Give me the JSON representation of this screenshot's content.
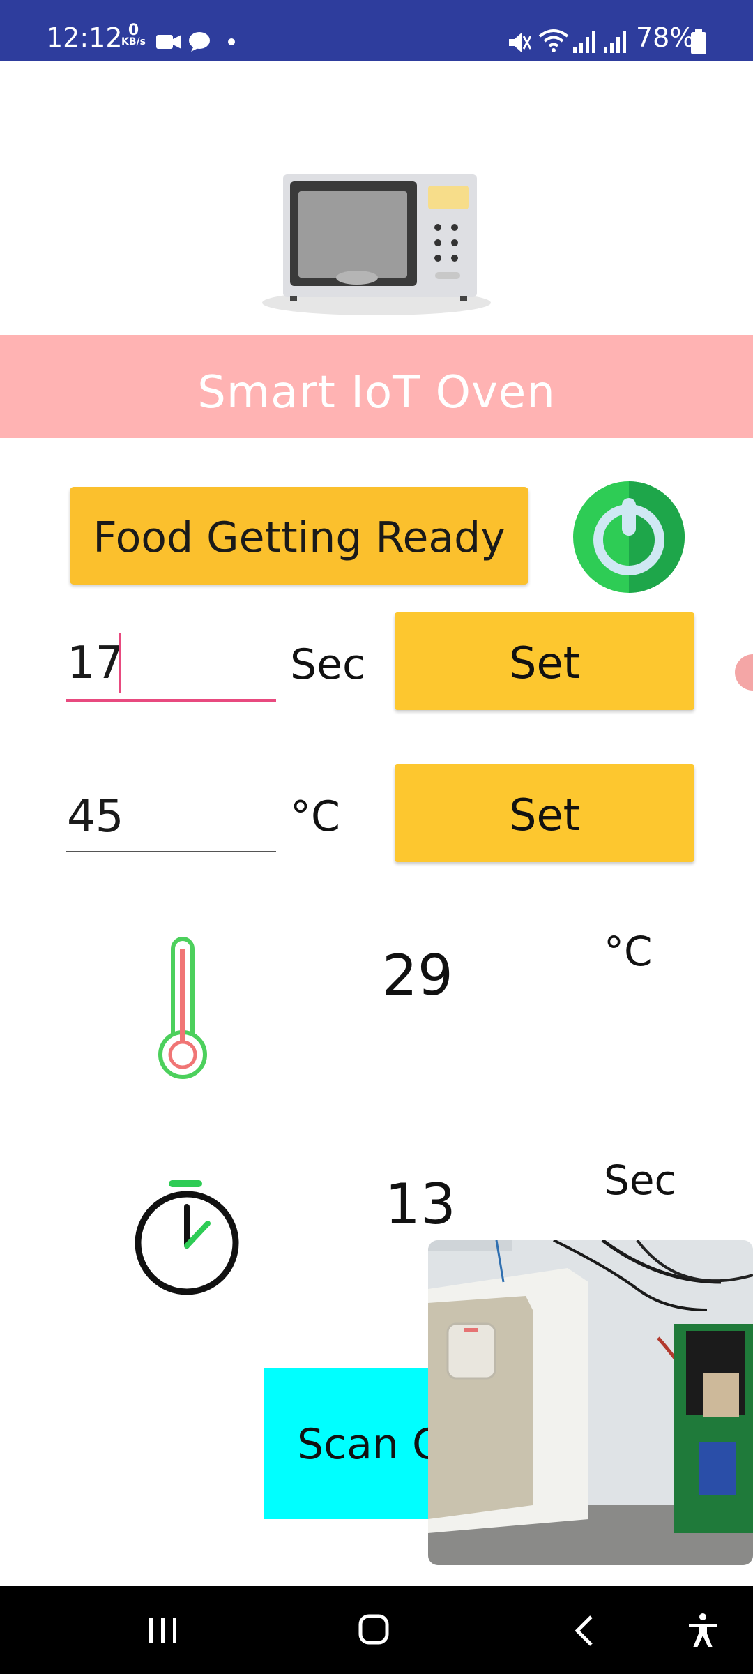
{
  "status_bar": {
    "time": "12:12",
    "data_rate_value": "0",
    "data_rate_unit": "KB/s",
    "battery_percent": "78%",
    "icons": [
      "video-camera-icon",
      "chat-bubble-icon",
      "dot-icon",
      "mute-icon",
      "wifi-icon",
      "signal-icon",
      "signal-icon",
      "battery-icon"
    ]
  },
  "app": {
    "title": "Smart IoT Oven",
    "status_label": "Food Getting Ready",
    "power_icon": "power-icon"
  },
  "controls": {
    "time_input_value": "17",
    "time_unit": "Sec",
    "time_set_label": "Set",
    "temp_input_value": "45",
    "temp_unit": "°C",
    "temp_set_label": "Set"
  },
  "readings": {
    "temperature_value": "29",
    "temperature_unit": "°C",
    "timer_value": "13",
    "timer_unit": "Sec"
  },
  "scan_button_label": "Scan Q",
  "colors": {
    "status_bar": "#2e3d9d",
    "banner": "#ffb3b3",
    "button_yellow": "#fdc72f",
    "scan_cyan": "#00ffff",
    "power_green": "#22c55e",
    "input_underline_active": "#e84a7f"
  },
  "navigation": {
    "recents_icon": "recents-icon",
    "home_icon": "home-icon",
    "back_icon": "back-icon",
    "accessibility_icon": "accessibility-icon"
  }
}
